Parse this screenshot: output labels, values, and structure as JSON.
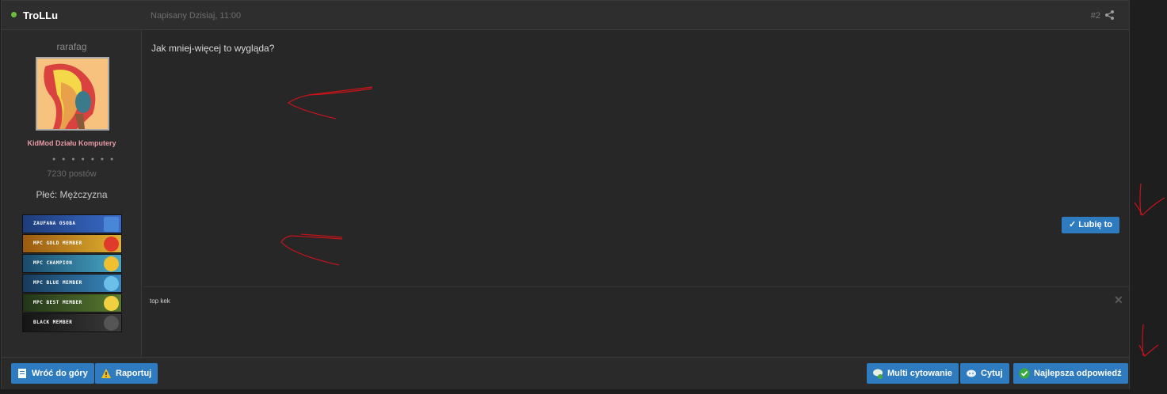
{
  "header": {
    "author": "TroLLu",
    "date": "Napisany Dzisiaj, 11:00",
    "post_number": "#2",
    "share_icon": "share-icon"
  },
  "sidebar": {
    "user_title": "rarafag",
    "rank_name": "KidMod Działu Komputery",
    "pips": "● ● ● ● ● ● ●",
    "post_count": "7230 postów",
    "gender": "Płeć: Mężczyzna",
    "badges": [
      {
        "label": "Zaufana osoba",
        "color": "#2a4f9a"
      },
      {
        "label": "MPC Gold member",
        "color": "#c98a1a"
      },
      {
        "label": "MPC Champion",
        "color": "#2b7d9c"
      },
      {
        "label": "MPC Blue member",
        "color": "#2a6ea0"
      },
      {
        "label": "MPC Best member",
        "color": "#3d5a2a"
      },
      {
        "label": "Black member",
        "color": "#2b2b2b"
      }
    ]
  },
  "content": {
    "text": "Jak mniej-więcej to wygląda?",
    "like_label": "✓ Lubię to",
    "signature": "top kek",
    "close_icon": "close-icon"
  },
  "footer": {
    "back_top": "Wróć do góry",
    "report": "Raportuj",
    "multi_quote": "Multi cytowanie",
    "quote": "Cytuj",
    "best_answer": "Najlepsza odpowiedź"
  },
  "colors": {
    "accent": "#2e7bbf",
    "online": "#6cbf3a",
    "rank": "#e79aa5",
    "annotation": "#c8131a"
  }
}
